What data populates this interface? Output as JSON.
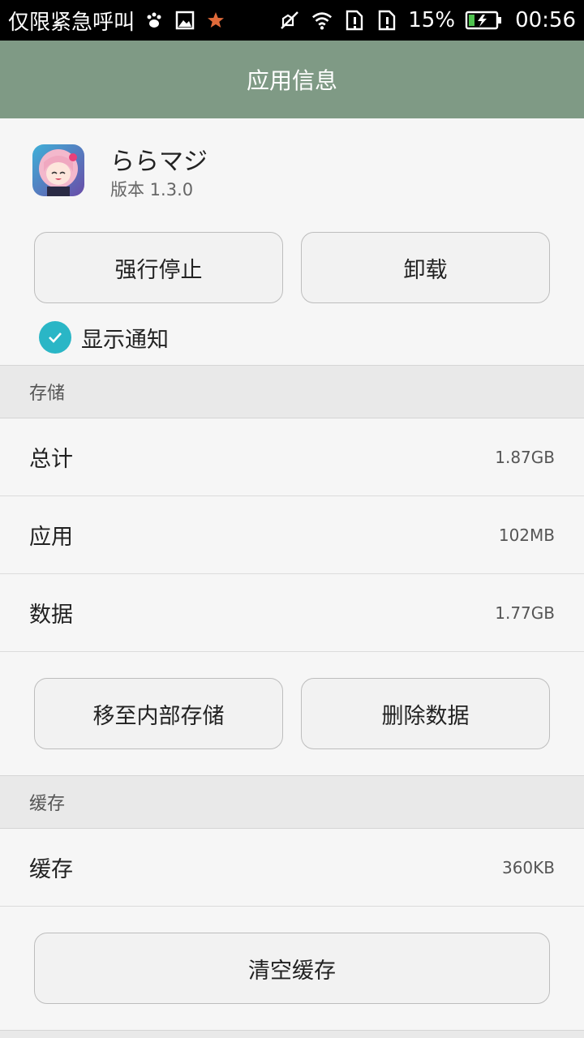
{
  "status_bar": {
    "carrier": "仅限紧急呼叫",
    "battery_percent": "15%",
    "time": "00:56",
    "icons": [
      "paw-icon",
      "image-icon",
      "star-icon",
      "mute-icon",
      "wifi-icon",
      "sim1-alert-icon",
      "sim2-alert-icon",
      "battery-charging-icon"
    ]
  },
  "title_bar": {
    "title": "应用信息"
  },
  "app": {
    "name": "ららマジ",
    "version": "版本 1.3.0"
  },
  "actions": {
    "force_stop": "强行停止",
    "uninstall": "卸载"
  },
  "notifications": {
    "label": "显示通知",
    "checked": true
  },
  "storage": {
    "header": "存储",
    "rows": [
      {
        "label": "总计",
        "value": "1.87GB"
      },
      {
        "label": "应用",
        "value": "102MB"
      },
      {
        "label": "数据",
        "value": "1.77GB"
      }
    ],
    "move_button": "移至内部存储",
    "clear_data_button": "删除数据"
  },
  "cache": {
    "header": "缓存",
    "row": {
      "label": "缓存",
      "value": "360KB"
    },
    "clear_cache_button": "清空缓存"
  },
  "colors": {
    "titlebar": "#7f9a85",
    "accent": "#2ab6c6"
  }
}
